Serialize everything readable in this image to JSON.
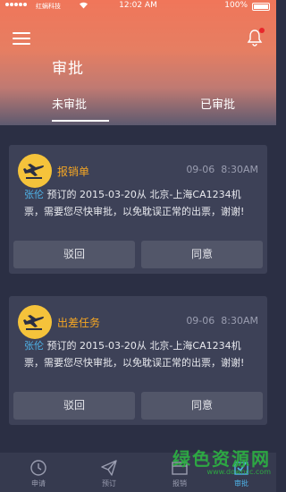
{
  "status_bar": {
    "carrier": "红蜗科技",
    "time": "12:02 AM",
    "battery": "100%"
  },
  "header": {
    "title": "审批",
    "menu_icon": "hamburger-menu-icon",
    "notification_icon": "bell-icon"
  },
  "tabs": [
    {
      "label": "未审批",
      "active": true
    },
    {
      "label": "已审批",
      "active": false
    }
  ],
  "cards": [
    {
      "icon": "plane-icon",
      "title": "报销单",
      "date": "09-06",
      "time": "8:30AM",
      "name": "张伦",
      "text": " 预订的 2015-03-20从 北京-上海CA1234机票，需要您尽快审批，以免耽误正常的出票，谢谢!",
      "reject_label": "驳回",
      "approve_label": "同意"
    },
    {
      "icon": "plane-icon",
      "title": "出差任务",
      "date": "09-06",
      "time": "8:30AM",
      "name": "张伦",
      "text": " 预订的 2015-03-20从 北京-上海CA1234机票，需要您尽快审批，以免耽误正常的出票，谢谢!",
      "reject_label": "驳回",
      "approve_label": "同意"
    }
  ],
  "bottom_nav": [
    {
      "label": "申请",
      "icon": "clock-icon",
      "active": false
    },
    {
      "label": "预订",
      "icon": "paper-plane-icon",
      "active": false
    },
    {
      "label": "报销",
      "icon": "folder-icon",
      "active": false
    },
    {
      "label": "审批",
      "icon": "checkbox-icon",
      "active": true
    }
  ],
  "watermark": {
    "text": "绿色资源网",
    "url": "www.downcc.com"
  },
  "colors": {
    "accent": "#4fb3e8",
    "title_orange": "#f5a623",
    "badge_yellow": "#f5c33b",
    "card_bg": "#3d4157",
    "page_bg": "#2b2f44"
  }
}
